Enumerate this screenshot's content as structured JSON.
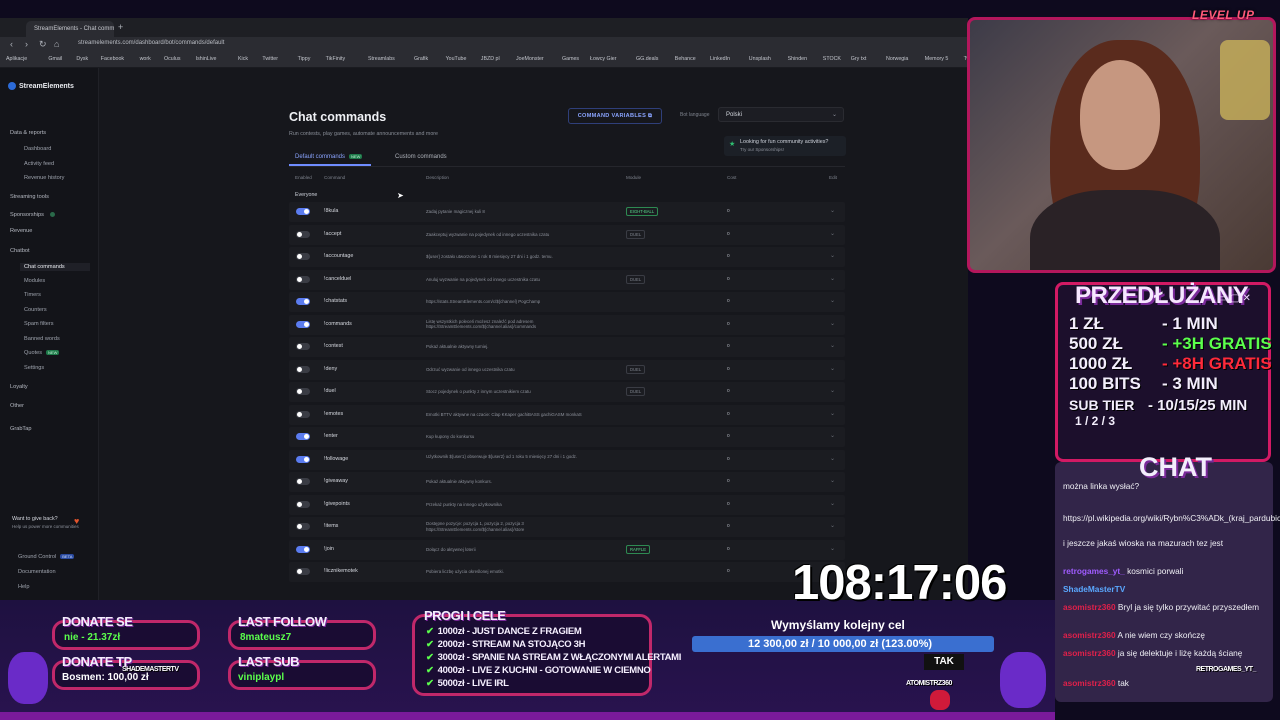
{
  "browser": {
    "tab_title": "StreamElements - Chat comma",
    "new_tab": "+",
    "url": "streamelements.com/dashboard/bot/commands/default",
    "bookmarks": [
      "Aplikacje",
      "Gmail",
      "Dysk",
      "Facebook",
      "work",
      "Oculus",
      "IshinLive",
      "Kick",
      "Twitter",
      "Tippy",
      "TikFinity",
      "Streamlabs",
      "Grafik",
      "YouTube",
      "JBZD pl",
      "JoeMonster",
      "Games",
      "Łowcy Gier",
      "GG.deals",
      "Behance",
      "LinkedIn",
      "Unsplash",
      "Shinden",
      "STOCK",
      "Gry txt",
      "Norwegia",
      "Memory 5",
      "Twitch"
    ]
  },
  "sidebar": {
    "brand": "StreamElements",
    "items": [
      {
        "label": "Data & reports",
        "type": "section"
      },
      {
        "label": "Dashboard",
        "type": "item"
      },
      {
        "label": "Activity feed",
        "type": "item"
      },
      {
        "label": "Revenue history",
        "type": "item"
      },
      {
        "label": "Streaming tools",
        "type": "section"
      },
      {
        "label": "Sponsorships",
        "type": "section"
      },
      {
        "label": "Revenue",
        "type": "section"
      },
      {
        "label": "Chatbot",
        "type": "section"
      },
      {
        "label": "Chat commands",
        "type": "active"
      },
      {
        "label": "Modules",
        "type": "item"
      },
      {
        "label": "Timers",
        "type": "item"
      },
      {
        "label": "Counters",
        "type": "item"
      },
      {
        "label": "Spam filters",
        "type": "item"
      },
      {
        "label": "Banned words",
        "type": "item"
      },
      {
        "label": "Quotes",
        "type": "item"
      },
      {
        "label": "Settings",
        "type": "item"
      },
      {
        "label": "Loyalty",
        "type": "section"
      },
      {
        "label": "Other",
        "type": "section"
      },
      {
        "label": "GrabTap",
        "type": "section"
      }
    ],
    "new_badge": "NEW",
    "giveback_title": "Want to give back?",
    "giveback_sub": "Help us power more communities",
    "bottom": [
      "Ground Control",
      "Documentation",
      "Help"
    ],
    "beta_badge": "BETA"
  },
  "main": {
    "title": "Chat commands",
    "subtitle": "Run contests, play games, automate announcements and more",
    "command_variables": "COMMAND VARIABLES",
    "bot_language_label": "Bot language",
    "bot_language": "Polski",
    "sponsor_title": "Looking for fun community activities?",
    "sponsor_sub": "Try our Sponsorships!",
    "tab_default": "Default commands",
    "tab_default_badge": "NEW",
    "tab_custom": "Custom commands",
    "columns": [
      "Enabled",
      "Command",
      "Description",
      "Module",
      "Cost",
      "Edit"
    ],
    "group": "Everyone",
    "rows": [
      {
        "on": true,
        "cmd": "!8kula",
        "desc": "Zadaj pytanie magicznej kuli 8",
        "mod": "EIGHT-BALL",
        "mod_green": true,
        "cost": "0"
      },
      {
        "on": false,
        "cmd": "!accept",
        "desc": "Zaakceptuj wyzwanie na pojedynek od innego uczestnika czatu",
        "mod": "DUEL",
        "mod_green": false,
        "cost": "0"
      },
      {
        "on": false,
        "cmd": "!accountage",
        "desc": "${user} zostało utworzone 1 rok 8 miesięcy 27 dni i 1 godz. temu.",
        "mod": "",
        "mod_green": false,
        "cost": "0"
      },
      {
        "on": false,
        "cmd": "!cancelduel",
        "desc": "Anuluj wyzwanie na pojedynek od innego uczestnika czatu",
        "mod": "DUEL",
        "mod_green": false,
        "cost": "0"
      },
      {
        "on": true,
        "cmd": "!chatstats",
        "desc": "https://stats.StreamElements.com/c/${channel} PogChamp",
        "mod": "",
        "mod_green": false,
        "cost": "0"
      },
      {
        "on": true,
        "cmd": "!commands",
        "desc": "Listę wszystkich poleceń możesz znaleźć pod adresem https://StreamElements.com/${channel.alias}/commands",
        "mod": "",
        "mod_green": false,
        "cost": "0"
      },
      {
        "on": false,
        "cmd": "!contest",
        "desc": "Pokaż aktualnie aktywny turniej.",
        "mod": "",
        "mod_green": false,
        "cost": "0"
      },
      {
        "on": false,
        "cmd": "!deny",
        "desc": "Odrzuć wyzwanie od innego uczestnika czatu",
        "mod": "DUEL",
        "mod_green": false,
        "cost": "0"
      },
      {
        "on": false,
        "cmd": "!duel",
        "desc": "Stocz pojedynek o punkty z innym uczestnikiem czatu",
        "mod": "DUEL",
        "mod_green": false,
        "cost": "0"
      },
      {
        "on": false,
        "cmd": "!emotes",
        "desc": "Emotki BTTV aktywne na czacie: Clap KKaper gachiBASS gachiGASM monkaS",
        "mod": "",
        "mod_green": false,
        "cost": "0"
      },
      {
        "on": true,
        "cmd": "!enter",
        "desc": "Kup kupony do konkursu",
        "mod": "",
        "mod_green": false,
        "cost": "0"
      },
      {
        "on": true,
        "cmd": "!followage",
        "desc": "Użytkownik ${user1} obserwuje ${user2} od 1 roku 5 miesięcy 27 dni i 1 godz.",
        "mod": "",
        "mod_green": false,
        "cost": "0"
      },
      {
        "on": false,
        "cmd": "!giveaway",
        "desc": "Pokaż aktualnie aktywny konkurs.",
        "mod": "",
        "mod_green": false,
        "cost": "0"
      },
      {
        "on": false,
        "cmd": "!givepoints",
        "desc": "Przekaż punkty na innego użytkownika",
        "mod": "",
        "mod_green": false,
        "cost": "0"
      },
      {
        "on": false,
        "cmd": "!items",
        "desc": "Dostępne pozycje: pozycja 1, pozycja 2, pozycja 3 https://StreamElements.com/${channel.alias}/store",
        "mod": "",
        "mod_green": false,
        "cost": "0"
      },
      {
        "on": true,
        "cmd": "!join",
        "desc": "Dołącz do aktywnej loterii",
        "mod": "RAFFLE",
        "mod_green": true,
        "cost": "0"
      },
      {
        "on": false,
        "cmd": "!licznikemotek",
        "desc": "Pobiera liczbę użycia określonej emotki.",
        "mod": "",
        "mod_green": false,
        "cost": "0"
      }
    ]
  },
  "overlay": {
    "levelup": "LEVEL UP",
    "przedluzany_title": "PRZEDŁUŻANY",
    "rates": [
      {
        "left": "1 ZŁ",
        "right": "- 1 MIN"
      },
      {
        "left": "500 ZŁ",
        "right": "- +3H GRATIS"
      },
      {
        "left": "1000 ZŁ",
        "right": "- +8H GRATIS"
      },
      {
        "left": "100 BITS",
        "right": "- 3 MIN"
      },
      {
        "left": "SUB TIER",
        "right": "- 10/15/25 MIN"
      }
    ],
    "tier_sub": "1 / 2 / 3",
    "chat_title": "CHAT",
    "chat": [
      {
        "name": "",
        "text": "można linka wysłać?"
      },
      {
        "name": "",
        "text": "https://pl.wikipedia.org/wiki/Rybn%C3%ADk_(kraj_pardubicki)"
      },
      {
        "name": "",
        "text": "i jeszcze jakaś wioska na mazurach tez jest"
      },
      {
        "name": "retrogames_yt_",
        "text": "kosmici porwali"
      },
      {
        "name": "ShadeMasterTV",
        "text": ""
      },
      {
        "name": "asomistrz360",
        "text": "Bryl ja się tylko przywitać przyszedłem"
      },
      {
        "name": "asomistrz360",
        "text": "A nie wiem czy skończę"
      },
      {
        "name": "asomistrz360",
        "text": "ja się delektuje i liżę każdą ścianę"
      },
      {
        "name": "asomistrz360",
        "text": "tak"
      }
    ],
    "timer": "108:17:06",
    "goal_title": "Wymyślamy kolejny cel",
    "goal_value": "12 300,00 zł / 10 000,00 zł (123.00%)",
    "tak": "TAK",
    "donate_se_label": "DONATE SE",
    "donate_se_value": "nie - 21.37zł",
    "donate_tp_label": "DONATE TP",
    "donate_tp_value": "Bosmen: 100,00 zł",
    "last_follow_label": "LAST FOLLOW",
    "last_follow_value": "8mateusz7",
    "last_sub_label": "LAST SUB",
    "last_sub_value": "viniplaypl",
    "progi_title": "PROGI I CELE",
    "progi": [
      "1000zł - JUST DANCE Z FRAGIEM",
      "2000zł - STREAM NA STOJĄCO 3H",
      "3000zł - SPANIE NA STREAM Z WŁĄCZONYMI ALERTAMI",
      "4000zł - LIVE Z KUCHNI - GOTOWANIE W CIEMNO",
      "5000zł - LIVE IRL"
    ],
    "overlay_names": [
      "SHADEMASTERTV",
      "RETROGAMES_YT_",
      "ATOMISTRZ360"
    ]
  }
}
